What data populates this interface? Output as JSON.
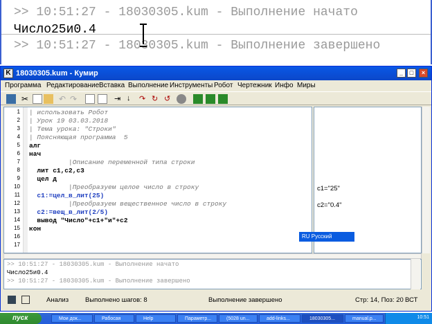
{
  "zoom": {
    "line1": ">> 10:51:27 - 18030305.kum - Выполнение начато",
    "line2": "Число25и0.4",
    "line3": ">> 10:51:27 - 18030305.kum - Выполнение завершено"
  },
  "window": {
    "title": "18030305.kum - Кумир",
    "app_icon_letter": "K",
    "menu": [
      "Программа",
      "Редактирование",
      "Вставка",
      "Выполнение",
      "Инструменты",
      "Робот",
      "Чертежник",
      "Инфо",
      "Миры"
    ]
  },
  "editor": {
    "line_numbers": [
      "1",
      "2",
      "3",
      "4",
      "5",
      "6",
      "7",
      "8",
      "9",
      "10",
      "11",
      "12",
      "13",
      "14",
      "15",
      "16",
      "17"
    ],
    "lines": [
      "| использовать Робот",
      "| Урок 19 03.03.2018",
      "| Тема урока: \"Строки\"",
      "| Поясняющая программа  5",
      "алг",
      "нач",
      "          |Описание переменной типа строки",
      "  лит c1,c2,c3",
      "  цел д",
      "          |Преобразуем целое число в строку",
      "  c1:=цел_в_лит(25)",
      "          |Преобразуем вещественное число в строку",
      "  c2:=вещ_в_лит(2/5)",
      "  вывод \"Число\"+c1+\"и\"+c2",
      "кон",
      "",
      ""
    ]
  },
  "margin": {
    "c1": "c1=\"25\"",
    "c2": "c2=\"0.4\""
  },
  "console": {
    "line1": ">> 10:51:27 - 18030305.kum - Выполнение начато",
    "line2": "Число25и0.4",
    "line3": ">> 10:51:27 - 18030305.kum - Выполнение завершено"
  },
  "status": {
    "mode": "Анализ",
    "steps": "Выполнено шагов: 8",
    "state": "Выполнение завершено",
    "position": "Стр: 14, Поз: 20",
    "insert": "ВСТ"
  },
  "language": "RU Русский",
  "taskbar": {
    "start": "пуск",
    "items": [
      "Мои док...",
      "Рабосая",
      "Help",
      "Параметр...",
      "(5028 un...",
      "add-links...",
      "18030305...",
      "manual.p..."
    ],
    "clock": "10:51"
  }
}
